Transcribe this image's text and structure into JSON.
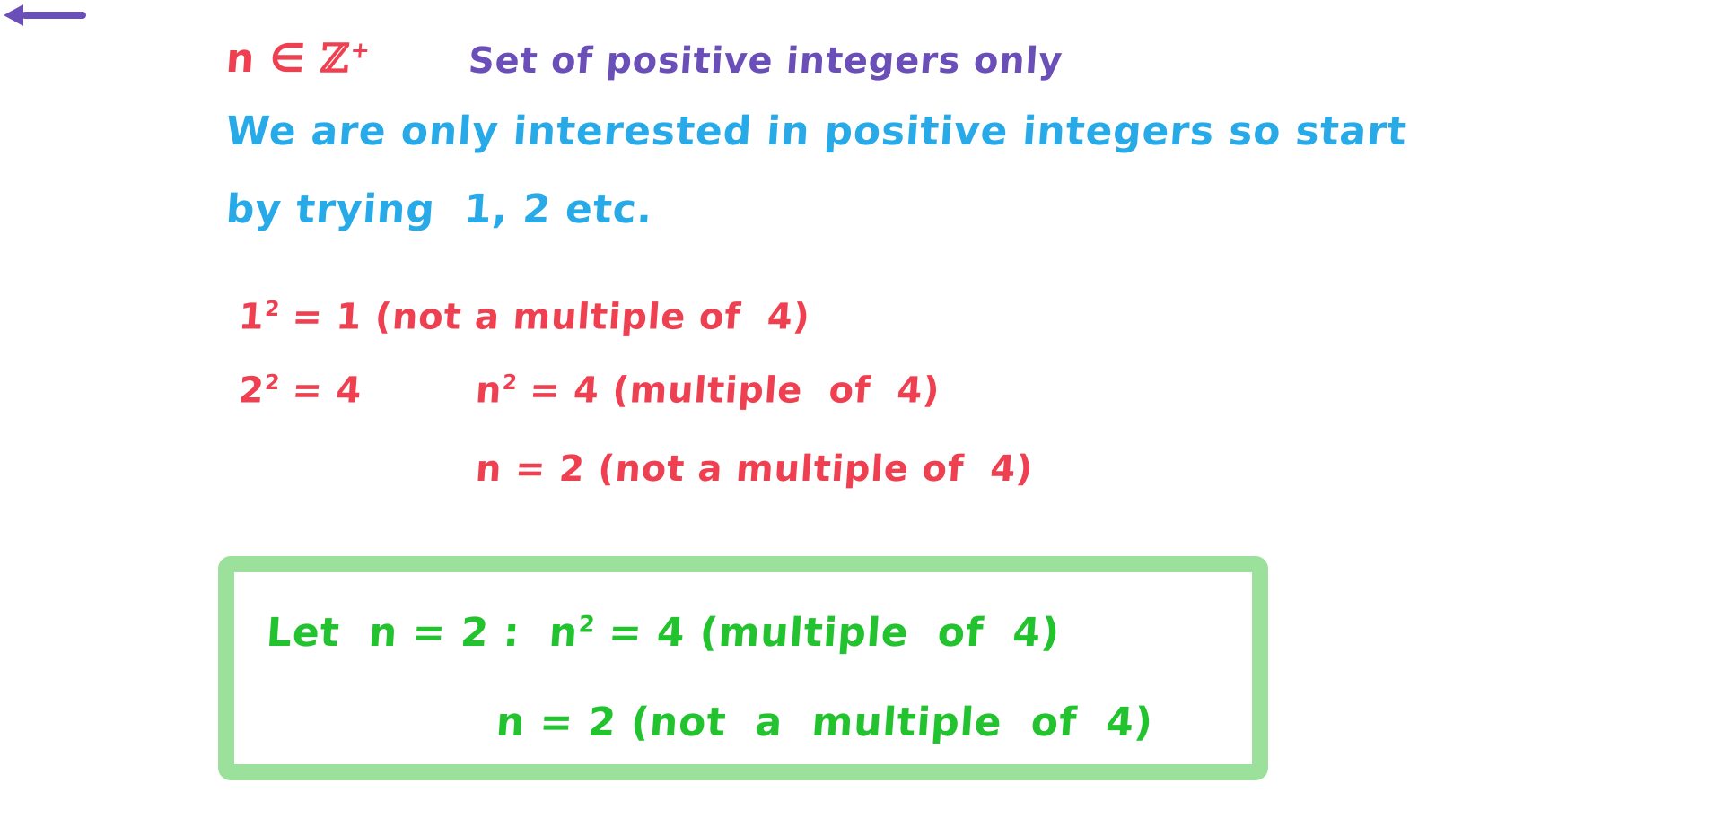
{
  "page": {
    "title": "Worked solution: counterexample for n squared multiple of 4",
    "background_color": "#FFFFFF"
  },
  "colors": {
    "red": "#EE4050",
    "purple": "#6B4FB8",
    "blue": "#29AAE8",
    "green_text": "#22C32E",
    "green_box_border": "#9BE09B",
    "box_fill": "#FFFFFF"
  },
  "line1": {
    "statement_prefix": "n ∈ ",
    "set_symbol": "ℤ",
    "set_superscript": "+",
    "arrow_icon": "left-arrow-icon",
    "annotation": "Set of positive integers only"
  },
  "explanation": {
    "line_1": "We are only interested in positive integers so start",
    "line_2": "by trying  1, 2 etc."
  },
  "working": {
    "line_1": {
      "base": "1",
      "exponent": "2",
      "rest": " = 1 (not a multiple of  4)"
    },
    "line_2_left": {
      "base": "2",
      "exponent": "2",
      "rest": " = 4"
    },
    "line_2_right": {
      "base": "n",
      "exponent": "2",
      "rest": " = 4 (multiple  of  4)"
    },
    "line_3": "n = 2 (not a multiple of  4)"
  },
  "answer_box": {
    "line_1_prefix": "Let  n = 2 :  ",
    "line_1_base": "n",
    "line_1_exponent": "2",
    "line_1_rest": " = 4 (multiple  of  4)",
    "line_2": "n = 2 (not  a  multiple  of  4)"
  }
}
